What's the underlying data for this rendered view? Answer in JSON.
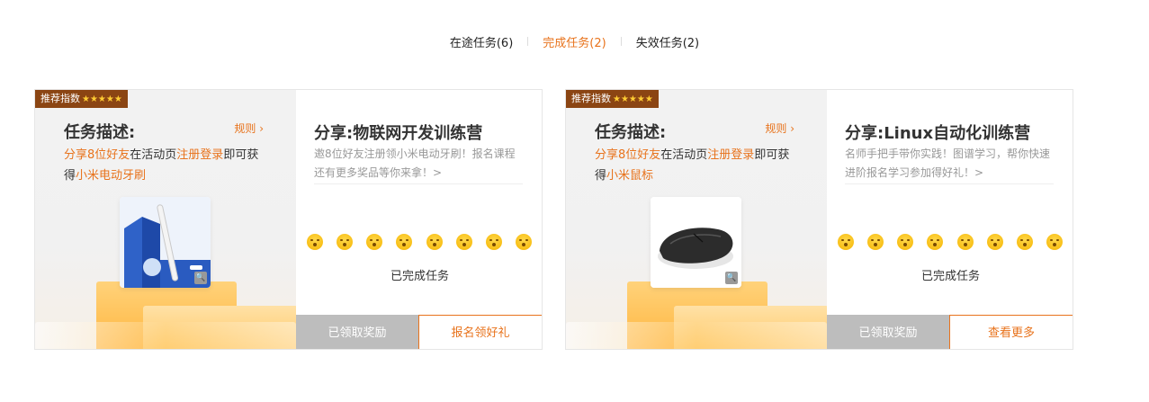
{
  "tabs": [
    {
      "label": "在途任务(6)",
      "active": false
    },
    {
      "label": "完成任务(2)",
      "active": true
    },
    {
      "label": "失效任务(2)",
      "active": false
    }
  ],
  "cards": [
    {
      "badge": "推荐指数",
      "stars": "★★★★★",
      "task_title": "任务描述:",
      "rules": "规则 ›",
      "desc": {
        "p1": "分享8位好友",
        "p2": "在活动页",
        "p3": "注册登录",
        "p4": "即可获得",
        "p5": "小米电动牙刷"
      },
      "product_icon": "electric-toothbrush",
      "zoom_icon": "🔍",
      "share_title": "分享:物联网开发训练营",
      "share_desc": "邀8位好友注册领小米电动牙刷！报名课程还有更多奖品等你来拿！>",
      "status": "已完成任务",
      "btn_claimed": "已领取奖励",
      "btn_cta": "报名领好礼"
    },
    {
      "badge": "推荐指数",
      "stars": "★★★★★",
      "task_title": "任务描述:",
      "rules": "规则 ›",
      "desc": {
        "p1": "分享8位好友",
        "p2": "在活动页",
        "p3": "注册登录",
        "p4": "即可获得",
        "p5": "小米鼠标"
      },
      "product_icon": "wireless-mouse",
      "zoom_icon": "🔍",
      "share_title": "分享:Linux自动化训练营",
      "share_desc": "名师手把手带你实践！图谱学习，帮你快速进阶报名学习参加得好礼！>",
      "status": "已完成任务",
      "btn_claimed": "已领取奖励",
      "btn_cta": "查看更多"
    }
  ]
}
